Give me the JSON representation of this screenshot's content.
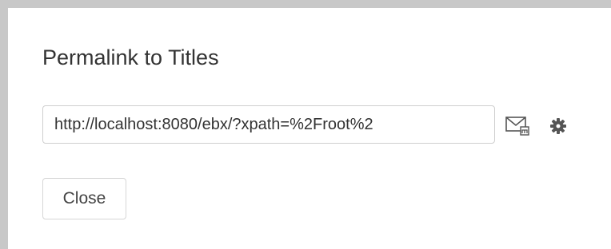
{
  "dialog": {
    "title": "Permalink to Titles",
    "permalink": {
      "value": "http://localhost:8080/ebx/?xpath=%2Froot%2"
    },
    "icons": {
      "mail": "mail-link-icon",
      "settings": "gear-icon"
    },
    "close_label": "Close"
  },
  "colors": {
    "frame_border": "#c8c8c8",
    "text": "#333333",
    "icon": "#555555"
  }
}
